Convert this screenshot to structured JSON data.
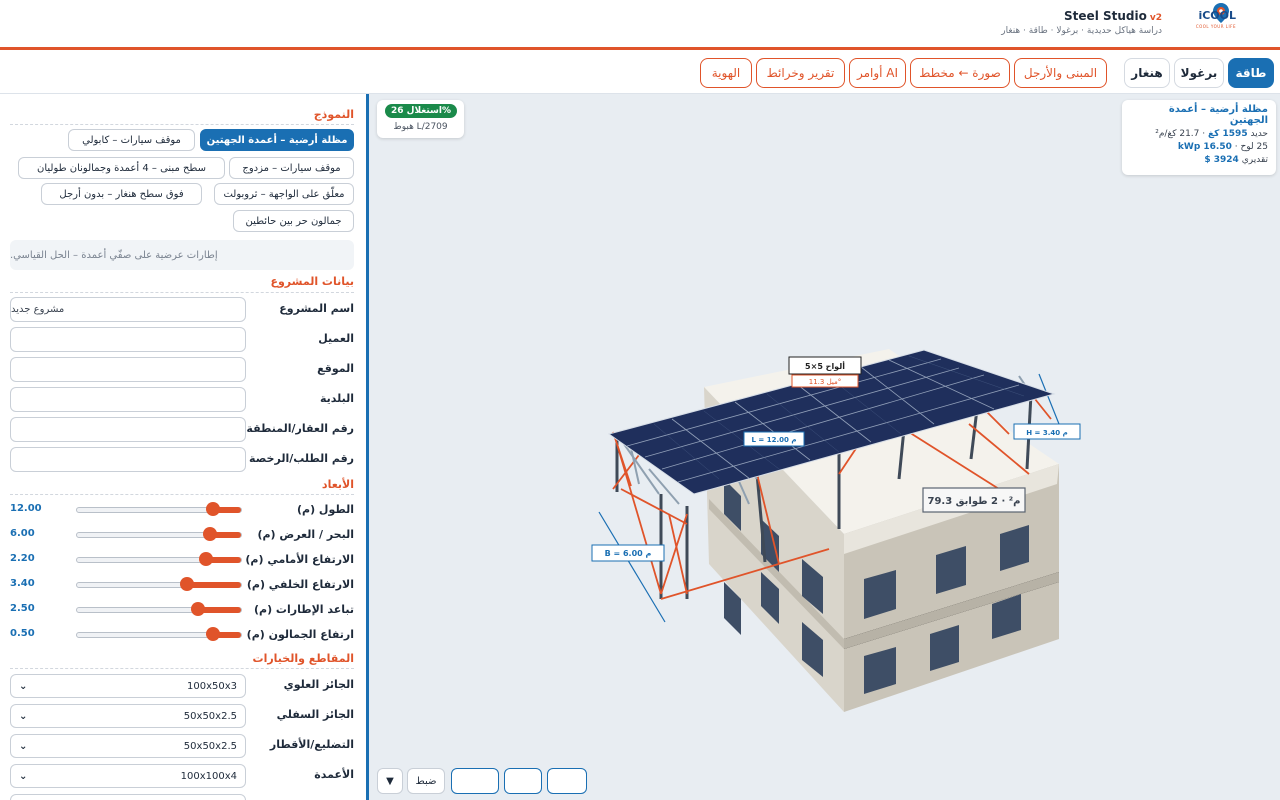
{
  "header": {
    "brand_name": "iCOOL",
    "brand_tagline": "COOL YOUR LIFE",
    "app_title": "Steel Studio",
    "version": "v2",
    "subtitle": "دراسة هياكل حديدية · برغولا · طاقة · هنغار"
  },
  "tabs": {
    "energy": "طاقة",
    "pergola": "برغولا",
    "hangar": "هنغار",
    "building": "المبنى والأرجل",
    "photo_plan": "صورة ← مخطط",
    "ai_commands": "أوامر AI",
    "reports_maps": "تقرير وخرائط",
    "identity": "الهوية"
  },
  "sidebar": {
    "model_title": "النموذج",
    "models": [
      "مظلة أرضية – أعمدة الجهتين",
      "موقف سيارات – كابولي",
      "موقف سيارات – مزدوج",
      "سطح مبنى – 4 أعمدة وجمالونان طوليان",
      "معلّق على الواجهة – ثروبولت",
      "فوق سطح هنغار – بدون أرجل",
      "جمالون حر بين حائطين"
    ],
    "model_note": "إطارات عرضية على صفّي أعمدة – الحل القياسي.",
    "project_title": "بيانات المشروع",
    "fields": [
      {
        "label": "اسم المشروع",
        "value": "مشروع جديد"
      },
      {
        "label": "العميل",
        "value": ""
      },
      {
        "label": "الموقع",
        "value": ""
      },
      {
        "label": "البلدية",
        "value": ""
      },
      {
        "label": "رقم العقار/المنطقة",
        "value": ""
      },
      {
        "label": "رقم الطلب/الرخصة",
        "value": ""
      }
    ],
    "dims_title": "الأبعاد",
    "sliders": [
      {
        "label": "الطول (م)",
        "value": "12.00",
        "fraction": 0.82
      },
      {
        "label": "البحر / العرض (م)",
        "value": "6.00",
        "fraction": 0.8
      },
      {
        "label": "الارتفاع الأمامي (م)",
        "value": "2.20",
        "fraction": 0.78
      },
      {
        "label": "الارتفاع الخلفي (م)",
        "value": "3.40",
        "fraction": 0.66
      },
      {
        "label": "تباعد الإطارات (م)",
        "value": "2.50",
        "fraction": 0.73
      },
      {
        "label": "ارتفاع الجمالون (م)",
        "value": "0.50",
        "fraction": 0.82
      }
    ],
    "sections_title": "المقاطع والخيارات",
    "selects": [
      {
        "label": "الجائز العلوي",
        "value": "100x50x3"
      },
      {
        "label": "الجائز السفلي",
        "value": "50x50x2.5"
      },
      {
        "label": "التضليع/الأقطار",
        "value": "50x50x2.5"
      },
      {
        "label": "الأعمدة",
        "value": "100x100x4"
      }
    ]
  },
  "viewport": {
    "usage_badge": "استغلال 26%",
    "deflection": "هبوط L/2709",
    "info": {
      "title": "مظلة أرضية – أعمدة الجهتين",
      "steel_label": "حديد",
      "steel_value": "1595 كغ",
      "steel_ratio": "· 21.7 كغ/م²",
      "panels": "25 لوح ·",
      "power": "16.50 kWp",
      "estimate_label": "تقديري",
      "estimate_value": "3924 $"
    },
    "dim_labels": {
      "length": "L = 12.00 م",
      "breadth": "B = 6.00 م",
      "height": "H = 3.40 م",
      "grid": "5×5 ألواح",
      "tilt": "ميل 11.3°",
      "area": "79.3 م² · 2 طوابق"
    },
    "tools": {
      "fit": "ضبط",
      "more_icon": "▼"
    }
  },
  "colors": {
    "accent": "#e0542a",
    "primary": "#1a6fb3",
    "success": "#1a8a4a",
    "panel": "#1f2f5c",
    "building": "#d8d4c8"
  }
}
